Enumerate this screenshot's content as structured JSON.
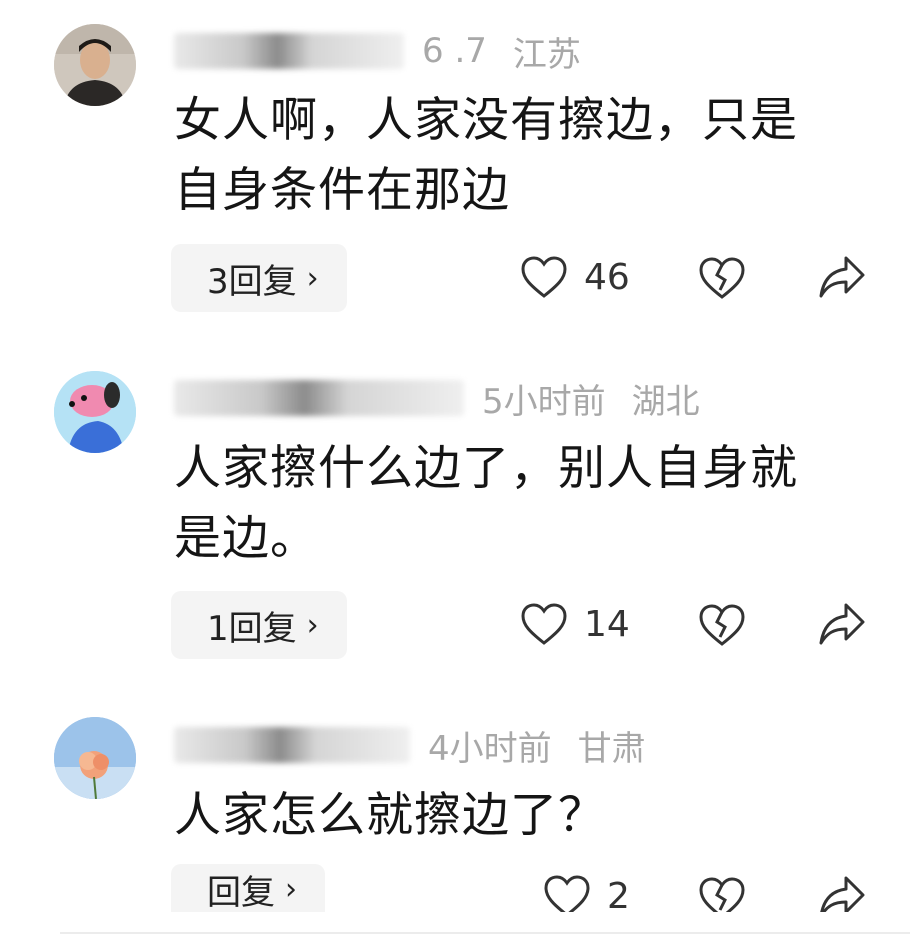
{
  "comments": [
    {
      "meta_partial": "6 .7",
      "location": "江苏",
      "text_line1": "女人啊，人家没有擦边，只是",
      "text_line2": "自身条件在那边",
      "replies": "3回复",
      "likes": "46",
      "avatar_icon": "person-photo-avatar"
    },
    {
      "time": "5小时前",
      "location": "湖北",
      "text_line1": "人家擦什么边了，别人自身就",
      "text_line2": "是边。",
      "replies": "1回复",
      "likes": "14",
      "avatar_icon": "cartoon-dog-avatar"
    },
    {
      "time": "4小时前",
      "location": "甘肃",
      "text_line1": "人家怎么就擦边了？",
      "replies": "回复",
      "likes": "2",
      "avatar_icon": "flower-avatar"
    }
  ],
  "chevron": "›",
  "colors": {
    "meta": "#a8a8a8",
    "reply_bg": "#f4f4f4",
    "text": "#151515"
  }
}
